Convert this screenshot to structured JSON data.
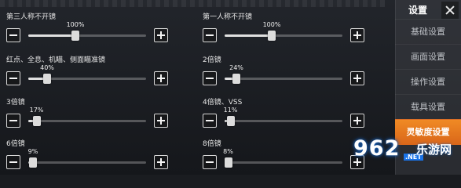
{
  "settings": [
    {
      "label": "第三人称不开镜",
      "value_text": "100%",
      "value": 0.4
    },
    {
      "label": "第一人称不开镜",
      "value_text": "100%",
      "value": 0.4
    },
    {
      "label": "红点、全息、机瞄、侧面瞄准镜",
      "value_text": "40%",
      "value": 0.16
    },
    {
      "label": "2倍镜",
      "value_text": "24%",
      "value": 0.1
    },
    {
      "label": "3倍镜",
      "value_text": "17%",
      "value": 0.07
    },
    {
      "label": "4倍镜、VSS",
      "value_text": "11%",
      "value": 0.05
    },
    {
      "label": "6倍镜",
      "value_text": "9%",
      "value": 0.04
    },
    {
      "label": "8倍镜",
      "value_text": "8%",
      "value": 0.03
    }
  ],
  "panel": {
    "title": "设置",
    "items": [
      {
        "label": "基础设置",
        "active": false
      },
      {
        "label": "画面设置",
        "active": false
      },
      {
        "label": "操作设置",
        "active": false
      },
      {
        "label": "载具设置",
        "active": false
      },
      {
        "label": "灵敏度设置",
        "active": true
      }
    ]
  },
  "watermark": {
    "number": "962",
    "net": ".NET",
    "site": "乐游网"
  },
  "colors": {
    "accent": "#e87a1f",
    "watermark_blue": "#1a73e8"
  }
}
